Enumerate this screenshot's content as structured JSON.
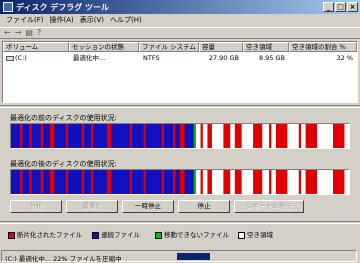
{
  "window": {
    "title": "ディスク デフラグ ツール"
  },
  "menu": [
    "ファイル(F)",
    "操作(A)",
    "表示(V)",
    "ヘルプ(H)"
  ],
  "volume_table": {
    "columns": [
      "ボリューム",
      "セッションの状態",
      "ファイル システム",
      "容量",
      "空き領域",
      "空き領域の割合 %"
    ],
    "rows": [
      {
        "volume": "(C:)",
        "status": "最適化中...",
        "fs": "NTFS",
        "capacity": "27.90 GB",
        "free": "8.95 GB",
        "free_pct": "32 %"
      }
    ]
  },
  "before_label": "最適化の前のディスクの使用状況:",
  "after_label": "最適化の後のディスクの使用状況:",
  "buttons": {
    "analyze": "分析",
    "defrag": "最適化",
    "pause": "一時停止",
    "stop": "停止",
    "report": "レポートの表示"
  },
  "legend": [
    {
      "label": "断片化されたファイル",
      "color": "#e00000"
    },
    {
      "label": "連続ファイル",
      "color": "#1010c0"
    },
    {
      "label": "移動できないファイル",
      "color": "#00c000"
    },
    {
      "label": "空き領域",
      "color": "#ffffff"
    }
  ],
  "status": {
    "text": "(C:) 最適化中... 22% ファイルを圧縮中",
    "progress": 0.22
  },
  "colors": {
    "fragmented": "#e00000",
    "contiguous": "#1010c0",
    "unmovable": "#00c000",
    "free": "#ffffff"
  },
  "disk_map": {
    "before": "BBBBRBBBRBBBBRBBBRRBBBBBRBBBBBBRBBBRBBBBBBRRBBBBBBBBRBBBBBRBBBBBBBRBBBBRBBRRBBBBGWWRWWRRWWWWWRRRWWRRRWWWWWRRRRWWWRWWRRRRRWWWWWRWWRRRRRWWWWWWWRRRRRWW",
    "after": "BBBBRBBBRBBBBRBBBRRBBBBBRBBBBBBRBBBRBBBBBBRRBBBBBBBBRBBBBBRBBBBBBBRBBBBRBBRRBBBBGWWRWWRRWWWWWRRRWWRRRWWWWWRRRRWWWRWWRRRRRWWWWWRWWRRRRRWWWWWWWRRRRRWW"
  }
}
